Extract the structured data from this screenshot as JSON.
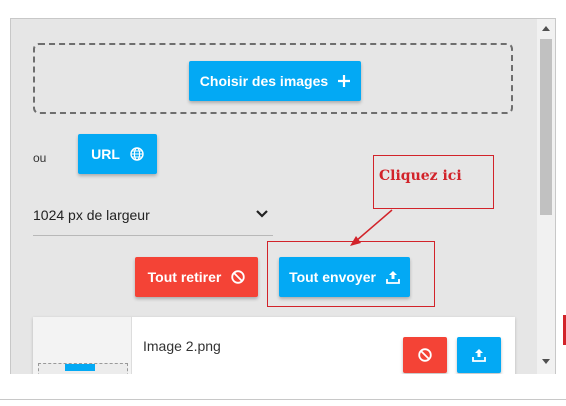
{
  "upload": {
    "choose_label": "Choisir des images",
    "or_label": "ou",
    "url_label": "URL",
    "width_select": "1024 px de largeur",
    "remove_all_label": "Tout retirer",
    "send_all_label": "Tout envoyer"
  },
  "file_list": [
    {
      "filename": "Image 2.png"
    }
  ],
  "annotation": {
    "callout_text": "Cliquez ici",
    "color": "#d2232a"
  },
  "colors": {
    "primary": "#03a9f4",
    "danger": "#f44336",
    "panel_bg": "#e6e6e6"
  },
  "icons": [
    "plus-icon",
    "globe-icon",
    "chevron-down-icon",
    "ban-icon",
    "upload-icon",
    "scroll-up-arrow-icon",
    "scroll-down-arrow-icon"
  ]
}
